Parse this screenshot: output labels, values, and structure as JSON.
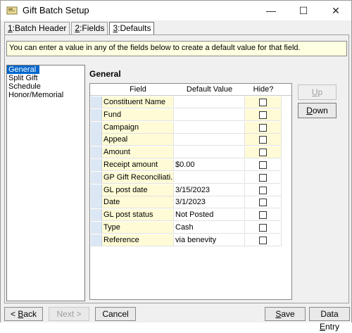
{
  "window": {
    "title": "Gift Batch Setup",
    "minimize_glyph": "—",
    "maximize_glyph": "☐",
    "close_glyph": "✕"
  },
  "tabs": [
    {
      "key": "1",
      "label": ":Batch Header",
      "active": false
    },
    {
      "key": "2",
      "label": ":Fields",
      "active": false
    },
    {
      "key": "3",
      "label": ":Defaults",
      "active": true
    }
  ],
  "info_text": "You can enter a value in any of the fields below to create a default value for that field.",
  "sidebar": {
    "items": [
      {
        "label": "General",
        "selected": true
      },
      {
        "label": "Split Gift",
        "selected": false
      },
      {
        "label": "Schedule",
        "selected": false
      },
      {
        "label": "Honor/Memorial",
        "selected": false
      }
    ]
  },
  "section_title": "General",
  "grid": {
    "columns": [
      "Field",
      "Default Value",
      "Hide?"
    ],
    "rows": [
      {
        "field": "Constituent Name",
        "value": "",
        "highlight": true
      },
      {
        "field": "Fund",
        "value": "",
        "highlight": true
      },
      {
        "field": "Campaign",
        "value": "",
        "highlight": true
      },
      {
        "field": "Appeal",
        "value": "",
        "highlight": true
      },
      {
        "field": "Amount",
        "value": "",
        "highlight": true
      },
      {
        "field": "Receipt amount",
        "value": "$0.00",
        "highlight": true
      },
      {
        "field": "GP Gift Reconciliati...",
        "value": "",
        "highlight": true
      },
      {
        "field": "GL post date",
        "value": "3/15/2023",
        "highlight": true
      },
      {
        "field": "Date",
        "value": "3/1/2023",
        "highlight": true
      },
      {
        "field": "GL post status",
        "value": "Not Posted",
        "highlight": true
      },
      {
        "field": "Type",
        "value": "Cash",
        "highlight": true
      },
      {
        "field": "Reference",
        "value": "via benevity",
        "highlight": true
      }
    ]
  },
  "buttons": {
    "up": {
      "key": "U",
      "rest": "p"
    },
    "down": {
      "key": "D",
      "rest": "own"
    },
    "back": {
      "pre": "< ",
      "key": "B",
      "rest": "ack"
    },
    "next": "Next >",
    "cancel": "Cancel",
    "save": {
      "key": "S",
      "rest": "ave"
    },
    "data_entry": {
      "pre": "Data ",
      "key": "E",
      "rest": "ntry"
    }
  },
  "colors": {
    "selection": "#0066cc",
    "highlight": "#fffbd6",
    "info_background": "#ffffe1"
  }
}
